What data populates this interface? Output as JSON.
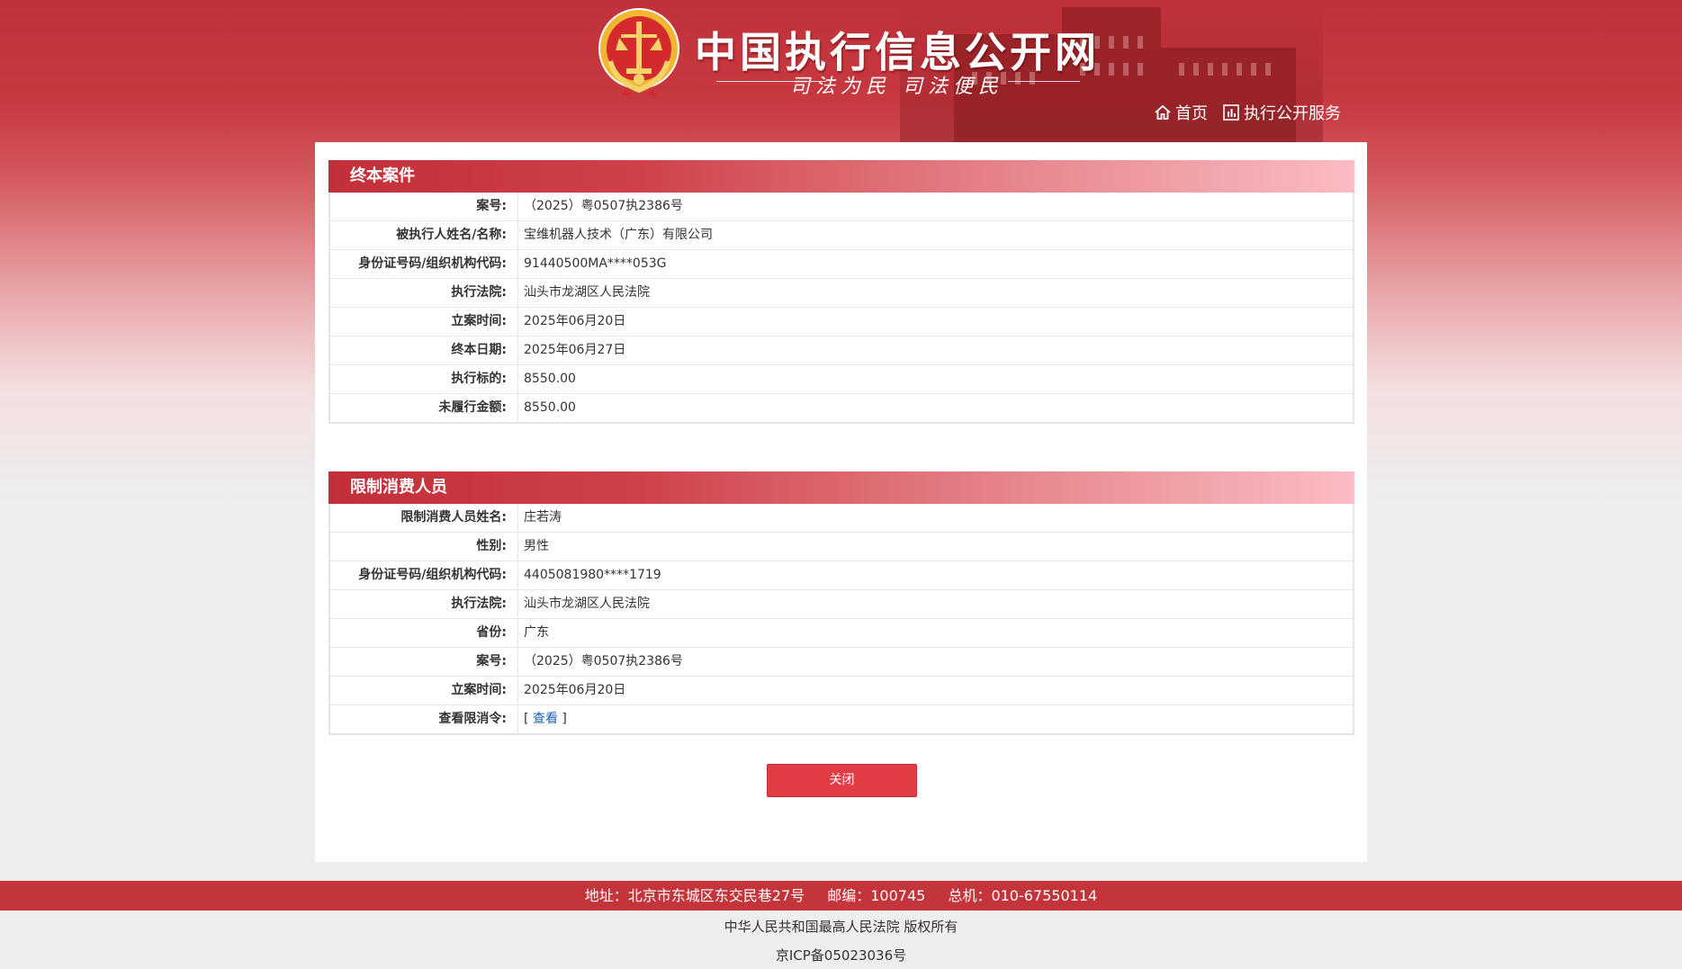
{
  "header": {
    "site_title": "中国执行信息公开网",
    "slogan": "司法为民 司法便民",
    "nav": [
      {
        "label": "首页",
        "icon": "home-icon"
      },
      {
        "label": "执行公开服务",
        "icon": "chart-icon"
      }
    ]
  },
  "final_case": {
    "title": "终本案件",
    "rows": [
      {
        "label": "案号:",
        "value": "（2025）粤0507执2386号"
      },
      {
        "label": "被执行人姓名/名称:",
        "value": "宝维机器人技术（广东）有限公司"
      },
      {
        "label": "身份证号码/组织机构代码:",
        "value": "91440500MA****053G"
      },
      {
        "label": "执行法院:",
        "value": "汕头市龙湖区人民法院"
      },
      {
        "label": "立案时间:",
        "value": "2025年06月20日"
      },
      {
        "label": "终本日期:",
        "value": "2025年06月27日"
      },
      {
        "label": "执行标的:",
        "value": "8550.00"
      },
      {
        "label": "未履行金额:",
        "value": "8550.00"
      }
    ]
  },
  "restricted": {
    "title": "限制消费人员",
    "rows": [
      {
        "label": "限制消费人员姓名:",
        "value": "庄若涛"
      },
      {
        "label": "性别:",
        "value": "男性"
      },
      {
        "label": "身份证号码/组织机构代码:",
        "value": "4405081980****1719"
      },
      {
        "label": "执行法院:",
        "value": "汕头市龙湖区人民法院"
      },
      {
        "label": "省份:",
        "value": "广东"
      },
      {
        "label": "案号:",
        "value": "（2025）粤0507执2386号"
      },
      {
        "label": "立案时间:",
        "value": "2025年06月20日"
      },
      {
        "label": "查看限消令:",
        "bracket_open": "[",
        "link": "查看",
        "bracket_close": "]"
      }
    ]
  },
  "close_button": "关闭",
  "footer": {
    "address": "地址：北京市东城区东交民巷27号",
    "postcode": "邮编：100745",
    "phone": "总机：010-67550114",
    "copyright": "中华人民共和国最高人民法院 版权所有",
    "icp": "京ICP备05023036号"
  },
  "colors": {
    "brand_red": "#c3343b",
    "button_red": "#e23c45",
    "link_blue": "#1a5fb4"
  }
}
